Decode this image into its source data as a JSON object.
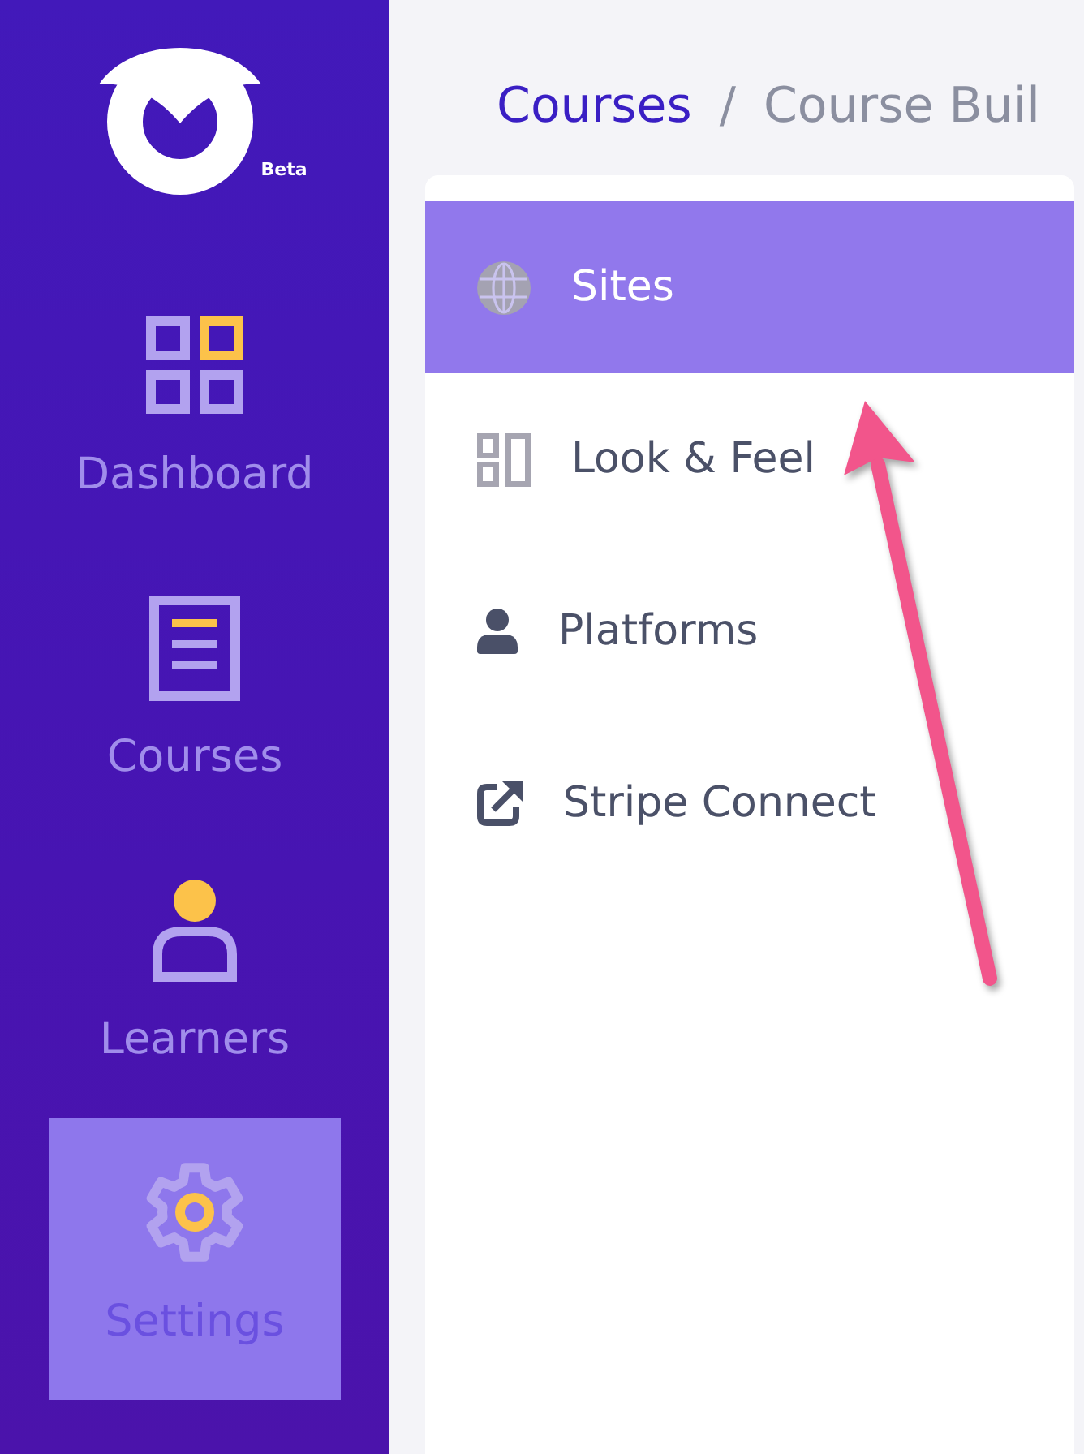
{
  "logo": {
    "badge": "Beta"
  },
  "nav": [
    {
      "label": "Dashboard",
      "kind": "dashboard",
      "selected": false
    },
    {
      "label": "Courses",
      "kind": "courses",
      "selected": false
    },
    {
      "label": "Learners",
      "kind": "learners",
      "selected": false
    },
    {
      "label": "Settings",
      "kind": "settings",
      "selected": true
    }
  ],
  "breadcrumb": [
    {
      "label": "Courses",
      "kind": "link"
    },
    {
      "label": "/",
      "kind": "separator"
    },
    {
      "label": "Course Buil",
      "kind": "current"
    }
  ],
  "settings_menu": [
    {
      "label": "Sites",
      "kind": "globe",
      "selected": true
    },
    {
      "label": "Look & Feel",
      "kind": "layout",
      "selected": false
    },
    {
      "label": "Platforms",
      "kind": "user",
      "selected": false
    },
    {
      "label": "Stripe Connect",
      "kind": "external",
      "selected": false
    }
  ]
}
